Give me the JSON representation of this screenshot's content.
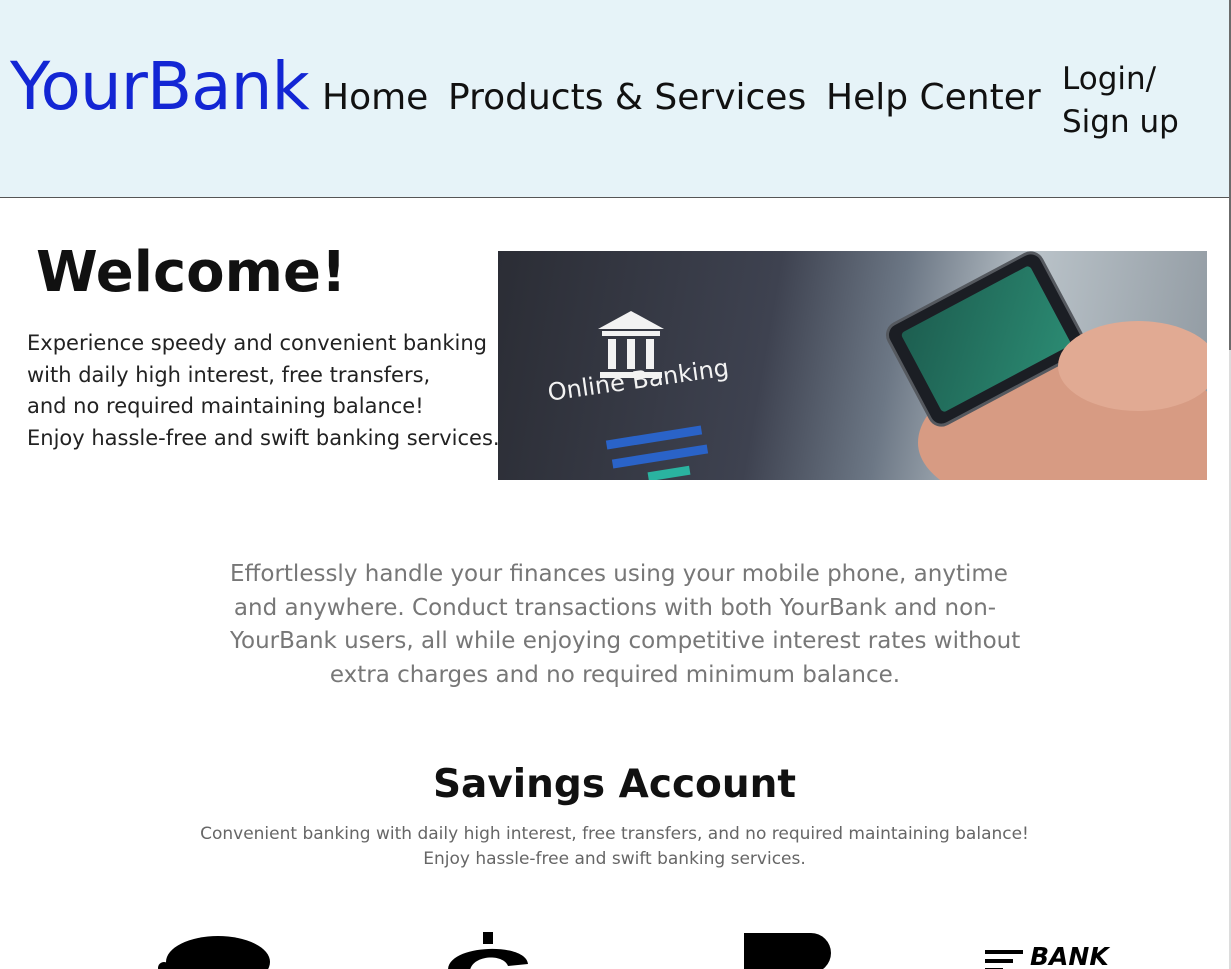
{
  "header": {
    "logo": "YourBank",
    "nav": {
      "home": "Home",
      "products": "Products & Services",
      "help": "Help Center",
      "login_line1": "Login/",
      "login_line2": "Sign up"
    }
  },
  "welcome": {
    "title": "Welcome!",
    "lines": [
      "Experience speedy and convenient banking",
      "with daily high interest, free transfers,",
      "and no required maintaining balance!",
      "Enjoy hassle-free and swift banking services."
    ]
  },
  "hero_image": {
    "label": "Online Banking",
    "icon": "bank-building-icon"
  },
  "intro": {
    "lines": [
      "Effortlessly handle your finances using your mobile phone, anytime",
      "and anywhere. Conduct transactions with both YourBank and non-",
      "YourBank users, all while enjoying competitive interest rates without",
      "extra charges and no required minimum balance."
    ]
  },
  "savings": {
    "title": "Savings Account",
    "desc_lines": [
      "Convenient banking with daily high interest, free transfers, and no required maintaining balance!",
      "Enjoy hassle-free and swift banking services."
    ]
  },
  "features": {
    "icons": [
      "piggy-bank-icon",
      "dollar-icon",
      "p-shape-icon",
      "bank-logo-icon"
    ],
    "bank_logo_text": "BANK"
  },
  "colors": {
    "header_bg": "#e6f3f8",
    "brand": "#1326d4",
    "muted_text": "#777777"
  }
}
